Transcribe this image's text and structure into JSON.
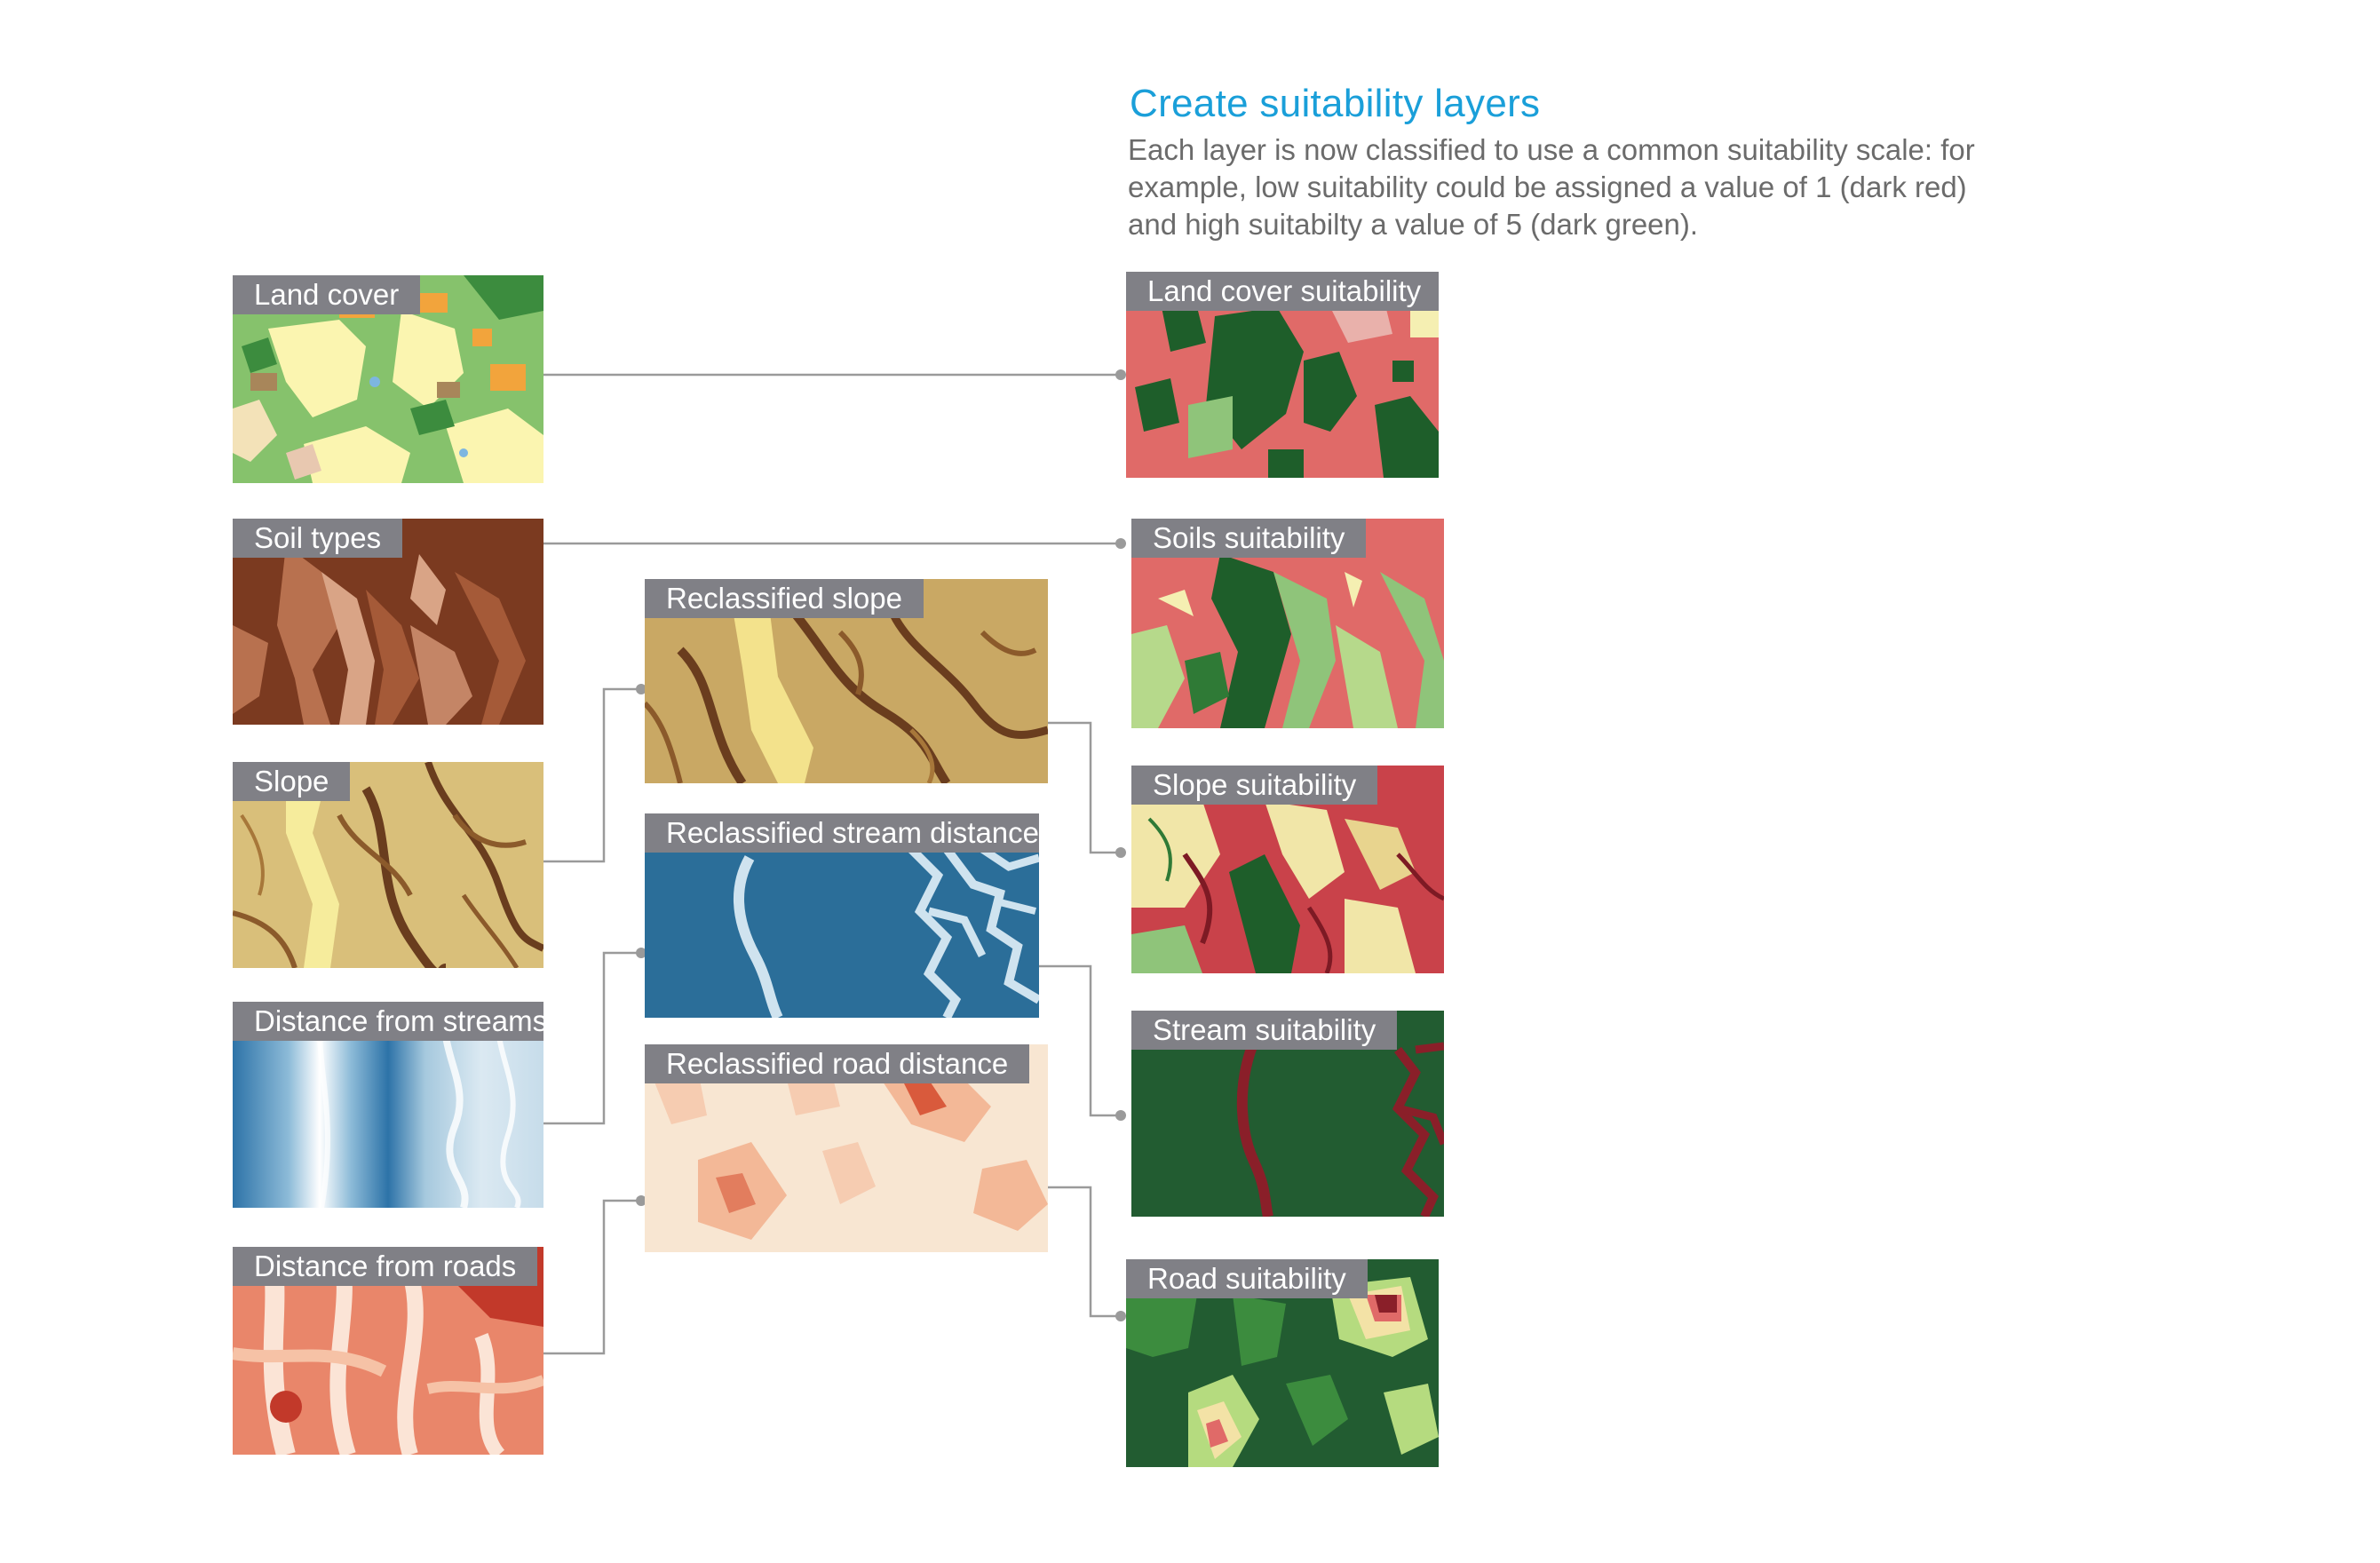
{
  "header": {
    "title": "Create suitability layers",
    "description": "Each layer is now classified to use a common suitability scale: for example, low suitability could be assigned a value of 1 (dark red) and high suitabilty a value of 5 (dark green)."
  },
  "colors": {
    "title": "#1a9fd9",
    "label_bg": "#808086",
    "connector": "#9a9a9a"
  },
  "inputs": [
    {
      "id": "land-cover",
      "label": "Land cover"
    },
    {
      "id": "soil-types",
      "label": "Soil types"
    },
    {
      "id": "slope",
      "label": "Slope"
    },
    {
      "id": "distance-streams",
      "label": "Distance from streams"
    },
    {
      "id": "distance-roads",
      "label": "Distance from roads"
    }
  ],
  "reclassified": [
    {
      "id": "reclass-slope",
      "label": "Reclassified slope"
    },
    {
      "id": "reclass-stream",
      "label": "Reclassified stream distance"
    },
    {
      "id": "reclass-road",
      "label": "Reclassified road distance"
    }
  ],
  "outputs": [
    {
      "id": "landcover-suit",
      "label": "Land cover suitability"
    },
    {
      "id": "soils-suit",
      "label": "Soils suitability"
    },
    {
      "id": "slope-suit",
      "label": "Slope suitability"
    },
    {
      "id": "stream-suit",
      "label": "Stream suitability"
    },
    {
      "id": "road-suit",
      "label": "Road suitability"
    }
  ]
}
